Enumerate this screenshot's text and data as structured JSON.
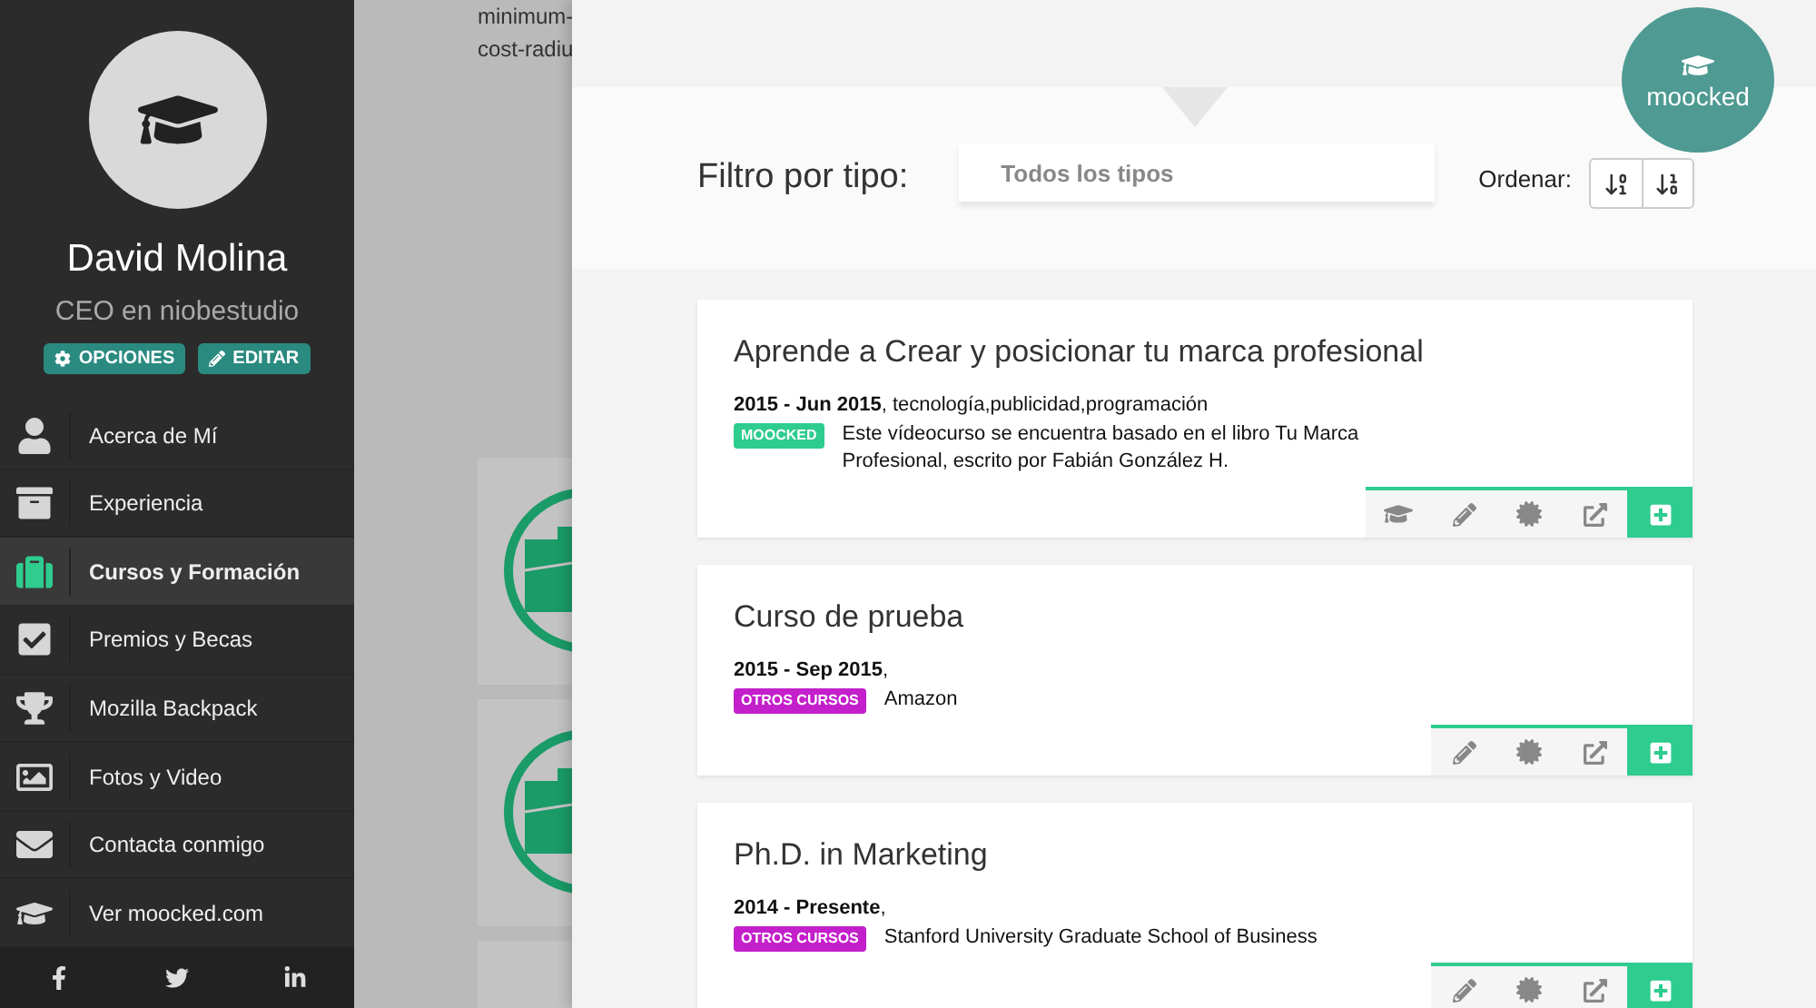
{
  "sidebar": {
    "name": "David Molina",
    "role": "CEO en niobestudio",
    "buttons": [
      {
        "label": "OPCIONES",
        "kind": "options"
      },
      {
        "label": "EDITAR",
        "kind": "edit"
      }
    ],
    "items": [
      {
        "label": "Acerca de Mí",
        "selected": false
      },
      {
        "label": "Experiencia",
        "selected": false
      },
      {
        "label": "Cursos y Formación",
        "selected": true
      },
      {
        "label": "Premios y Becas",
        "selected": false
      },
      {
        "label": "Mozilla Backpack",
        "selected": false
      },
      {
        "label": "Fotos y Video",
        "selected": false
      },
      {
        "label": "Contacta conmigo",
        "selected": false
      },
      {
        "label": "Ver  moocked.com",
        "selected": false
      }
    ]
  },
  "background_page": {
    "text_lines": [
      "minimum-",
      "cost-radiu"
    ]
  },
  "logo": {
    "text": "moocked"
  },
  "filter": {
    "label": "Filtro por tipo:",
    "value": "Todos los tipos"
  },
  "sort": {
    "label": "Ordenar:"
  },
  "cards": [
    {
      "title": "Aprende a Crear y posicionar tu marca profesional",
      "meta": "**2015 - Jun 2015**, tecnología,publicidad,programación",
      "tag": {
        "label": "MOOCKED",
        "color": "#2ecc8f"
      },
      "description": "Este vídeocurso se encuentra basado en el libro Tu Marca Profesional, escrito por Fabián González H.",
      "course_action": true
    },
    {
      "title": "Curso de prueba",
      "meta": "**2015 - Sep 2015**,",
      "tag": {
        "label": "OTROS CURSOS",
        "color": "#c31fcb"
      },
      "description": "Amazon",
      "course_action": false
    },
    {
      "title": "Ph.D. in Marketing",
      "meta": "**2014 - Presente**,",
      "tag": {
        "label": "OTROS CURSOS",
        "color": "#c31fcb"
      },
      "description": "Stanford University Graduate School of Business",
      "course_action": false
    }
  ]
}
